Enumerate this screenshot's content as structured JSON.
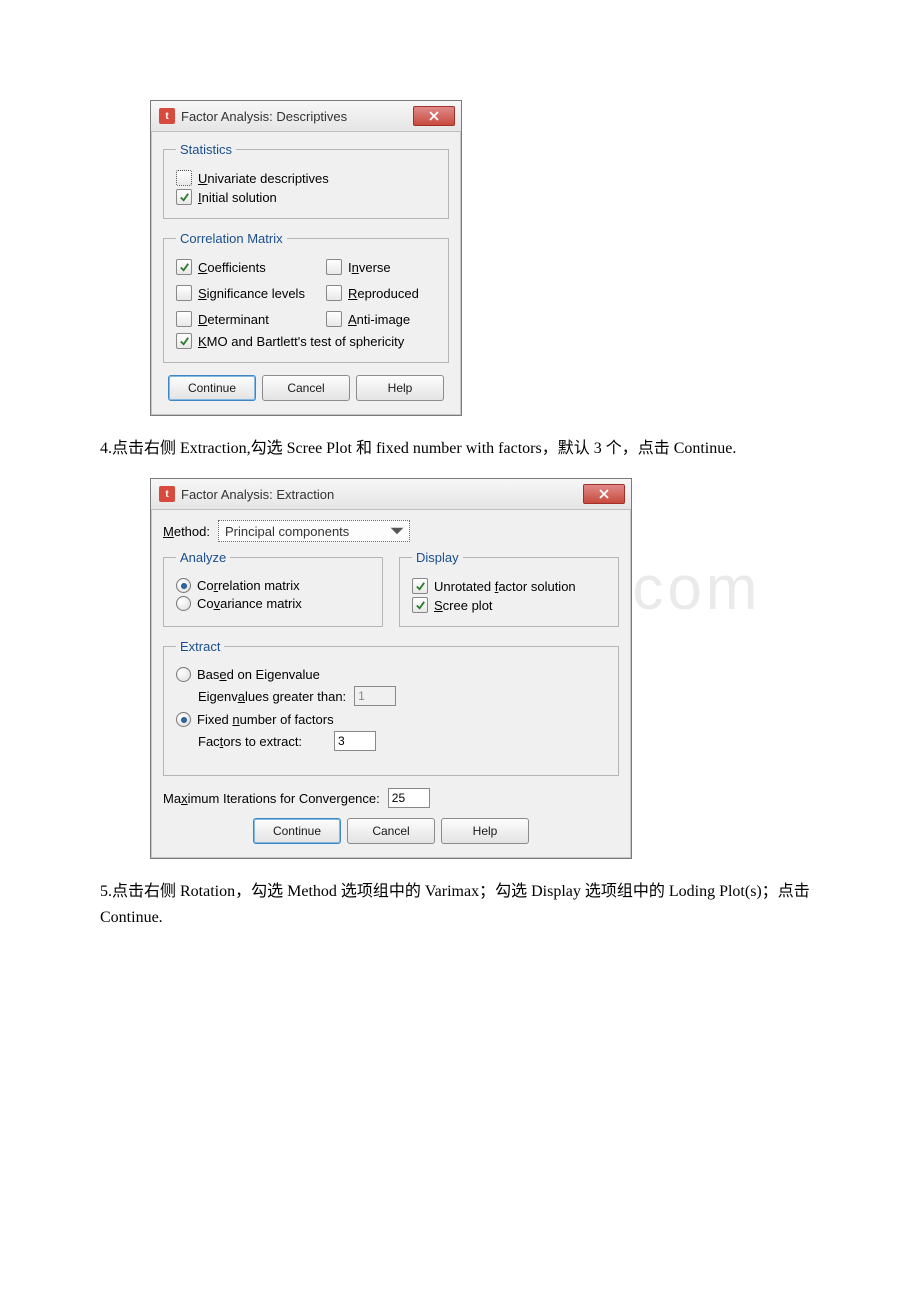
{
  "dialog1": {
    "title": "Factor Analysis: Descriptives",
    "statistics": {
      "legend": "Statistics",
      "univariate": "Univariate descriptives",
      "initial": "Initial solution"
    },
    "corr": {
      "legend": "Correlation Matrix",
      "coefficients": "Coefficients",
      "inverse": "Inverse",
      "sig": "Significance levels",
      "reproduced": "Reproduced",
      "determinant": "Determinant",
      "anti": "Anti-image",
      "kmo": "KMO and Bartlett's test of sphericity"
    },
    "buttons": {
      "continue": "Continue",
      "cancel": "Cancel",
      "help": "Help"
    }
  },
  "para4": "4.点击右侧 Extraction,勾选 Scree Plot 和 fixed number with factors，默认 3 个，点击 Continue.",
  "watermark": "www.docx.com",
  "dialog2": {
    "title": "Factor Analysis: Extraction",
    "method": {
      "label": "Method:",
      "value": "Principal components"
    },
    "analyze": {
      "legend": "Analyze",
      "corr": "Correlation matrix",
      "cov": "Covariance matrix"
    },
    "display": {
      "legend": "Display",
      "unrotated": "Unrotated factor solution",
      "scree": "Scree plot"
    },
    "extract": {
      "legend": "Extract",
      "eigen": "Based on Eigenvalue",
      "eigen_gt": "Eigenvalues greater than:",
      "eigen_val": "1",
      "fixed": "Fixed number of factors",
      "factors_label": "Factors to extract:",
      "factors_val": "3"
    },
    "maxiter": {
      "label": "Maximum Iterations for Convergence:",
      "value": "25"
    },
    "buttons": {
      "continue": "Continue",
      "cancel": "Cancel",
      "help": "Help"
    }
  },
  "para5": "5.点击右侧 Rotation，勾选 Method 选项组中的 Varimax；勾选 Display 选项组中的 Loding Plot(s)；点击 Continue."
}
